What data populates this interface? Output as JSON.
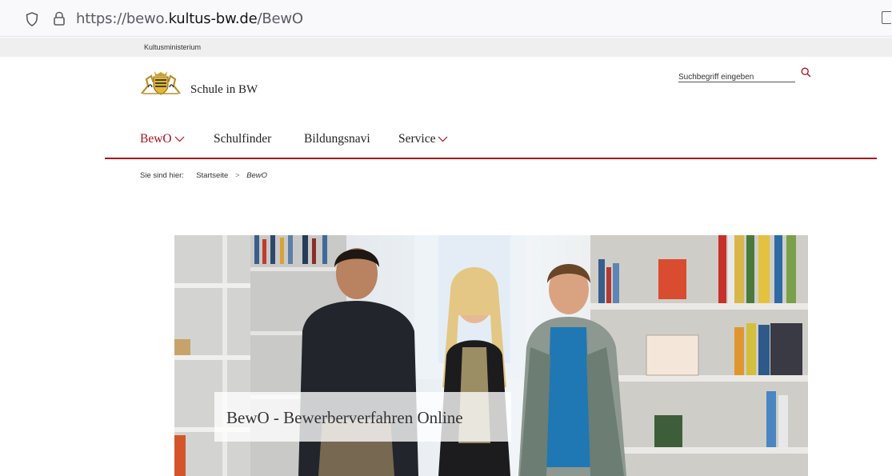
{
  "browser": {
    "url_prefix": "https://bewo.",
    "url_domain": "kultus-bw.de",
    "url_path": "/BewO"
  },
  "header": {
    "ministry": "Kultusministerium",
    "brand": "Schule in BW",
    "search_placeholder": "Suchbegriff eingeben"
  },
  "nav": {
    "items": [
      {
        "label": "BewO",
        "has_dropdown": true,
        "active": true
      },
      {
        "label": "Schulfinder",
        "has_dropdown": false,
        "active": false
      },
      {
        "label": "Bildungsnavi",
        "has_dropdown": false,
        "active": false
      },
      {
        "label": "Service",
        "has_dropdown": true,
        "active": false
      }
    ]
  },
  "breadcrumb": {
    "prefix": "Sie sind hier:",
    "home": "Startseite",
    "separator": ">",
    "current": "BewO"
  },
  "hero": {
    "title": "BewO - Bewerberverfahren Online"
  },
  "colors": {
    "accent": "#a8121e",
    "strip": "#efefef"
  }
}
